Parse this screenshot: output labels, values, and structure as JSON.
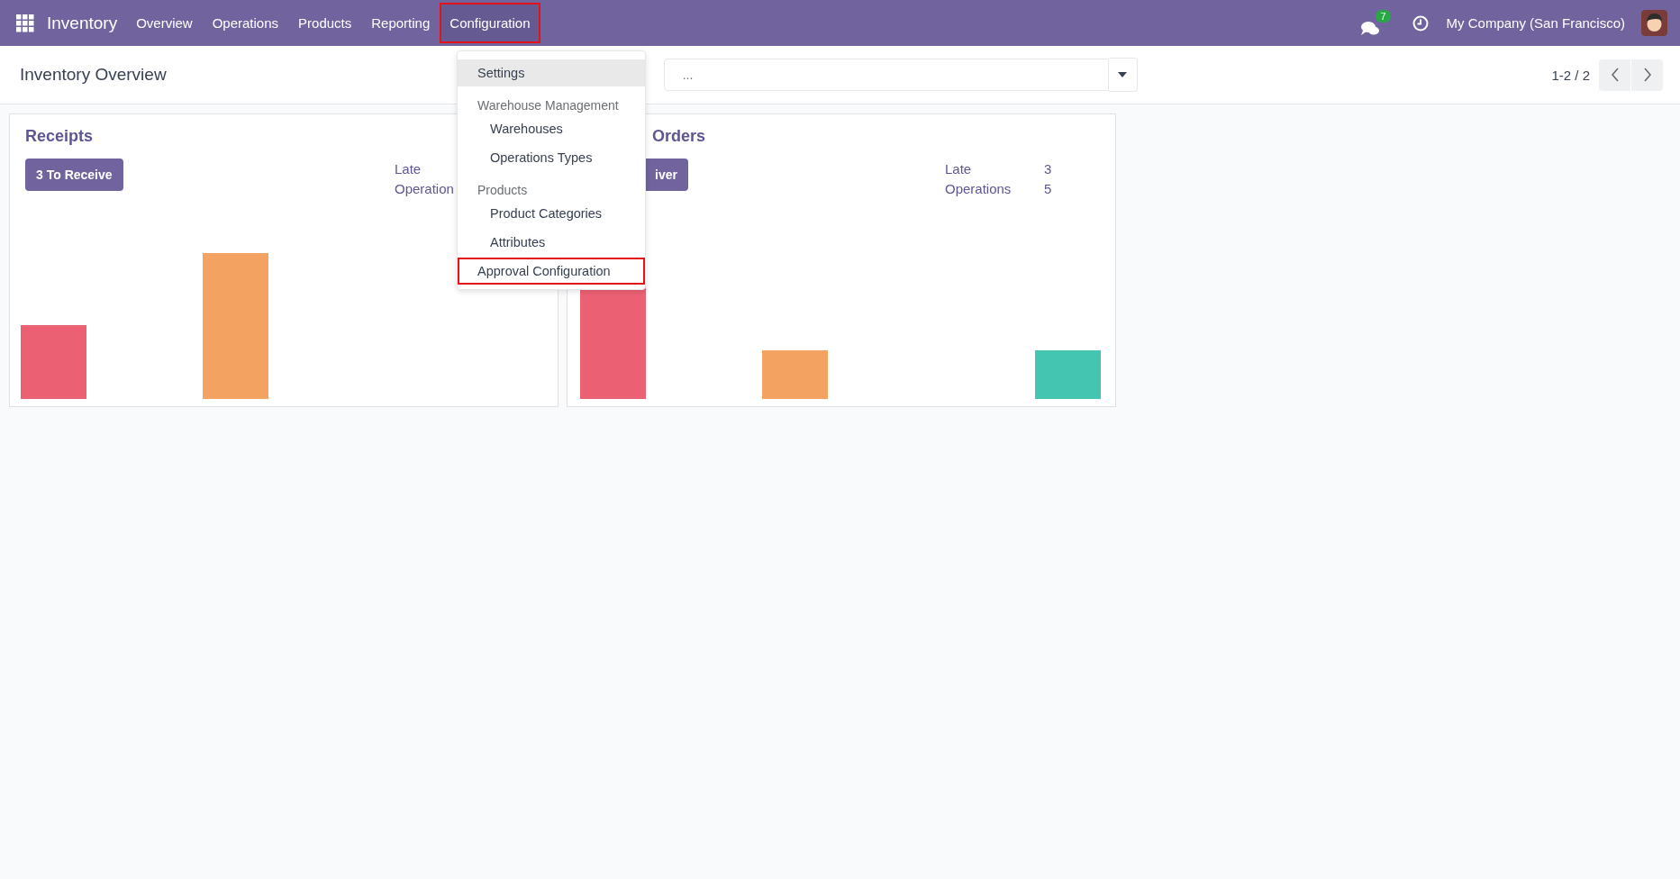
{
  "navbar": {
    "app_name": "Inventory",
    "menu": [
      {
        "label": "Overview",
        "selected": false,
        "outlined": false
      },
      {
        "label": "Operations",
        "selected": false,
        "outlined": false
      },
      {
        "label": "Products",
        "selected": false,
        "outlined": false
      },
      {
        "label": "Reporting",
        "selected": false,
        "outlined": false
      },
      {
        "label": "Configuration",
        "selected": true,
        "outlined": true
      }
    ],
    "messages_badge": "7",
    "company": "My Company (San Francisco)"
  },
  "control_panel": {
    "title": "Inventory Overview",
    "search": {
      "placeholder": "..."
    },
    "pager": "1-2 / 2"
  },
  "dropdown": [
    {
      "kind": "item",
      "label": "Settings",
      "selected": true,
      "outlined": false
    },
    {
      "kind": "header",
      "label": "Warehouse Management"
    },
    {
      "kind": "subitem",
      "label": "Warehouses",
      "selected": false,
      "outlined": false
    },
    {
      "kind": "subitem",
      "label": "Operations Types",
      "selected": false,
      "outlined": false
    },
    {
      "kind": "header",
      "label": "Products"
    },
    {
      "kind": "subitem",
      "label": "Product Categories",
      "selected": false,
      "outlined": false
    },
    {
      "kind": "subitem",
      "label": "Attributes",
      "selected": false,
      "outlined": false
    },
    {
      "kind": "item",
      "label": "Approval Configuration",
      "selected": false,
      "outlined": true
    }
  ],
  "cards": [
    {
      "title": "Receipts",
      "button": "3 To Receive",
      "stats": [
        {
          "label": "Late"
        },
        {
          "label": "Operation"
        }
      ]
    },
    {
      "title": "Orders",
      "button": "iver",
      "stats": [
        {
          "label": "Late",
          "value": "3"
        },
        {
          "label": "Operations",
          "value": "5"
        }
      ]
    }
  ]
}
